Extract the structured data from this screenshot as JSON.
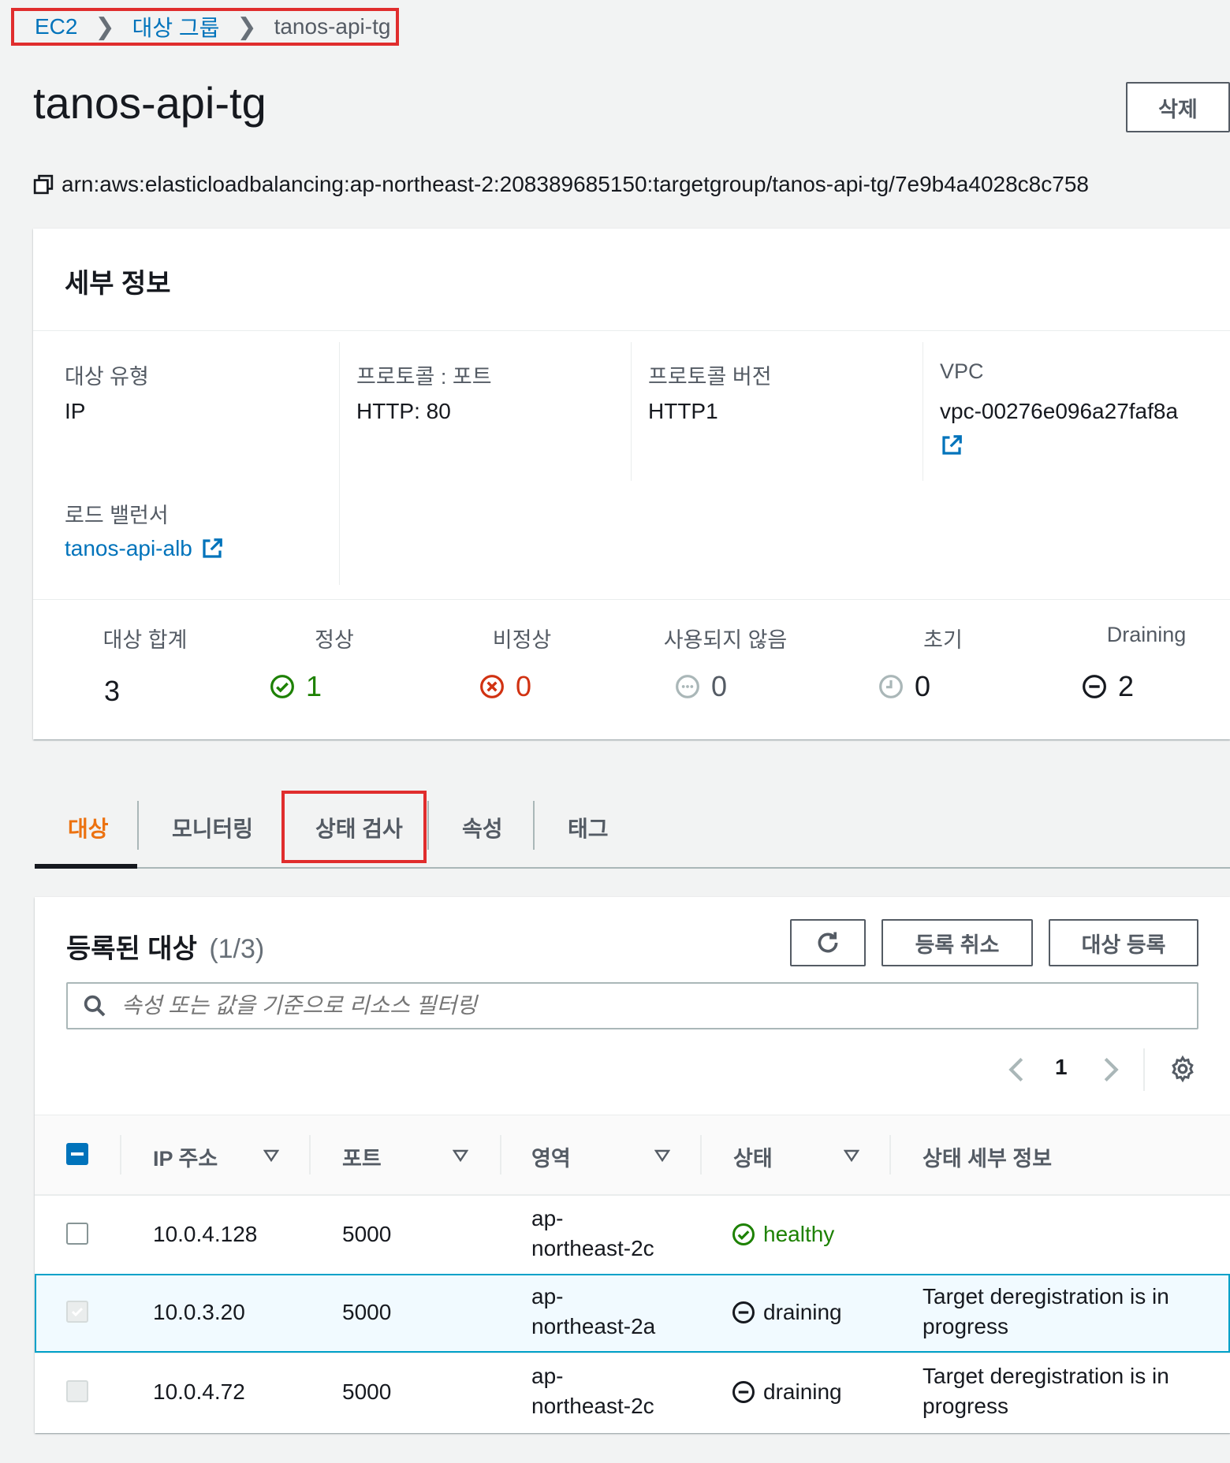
{
  "breadcrumb": {
    "items": [
      "EC2",
      "대상 그룹"
    ],
    "current": "tanos-api-tg"
  },
  "header": {
    "title": "tanos-api-tg",
    "delete_label": "삭제",
    "arn": "arn:aws:elasticloadbalancing:ap-northeast-2:208389685150:targetgroup/tanos-api-tg/7e9b4a4028c8c758"
  },
  "details": {
    "title": "세부 정보",
    "target_type_label": "대상 유형",
    "target_type": "IP",
    "protocol_port_label": "프로토콜 : 포트",
    "protocol_port": "HTTP: 80",
    "protocol_version_label": "프로토콜 버전",
    "protocol_version": "HTTP1",
    "vpc_label": "VPC",
    "vpc": "vpc-00276e096a27faf8a",
    "lb_label": "로드 밸런서",
    "lb": "tanos-api-alb"
  },
  "stats": {
    "total_label": "대상 합계",
    "total": "3",
    "healthy_label": "정상",
    "healthy": "1",
    "unhealthy_label": "비정상",
    "unhealthy": "0",
    "unused_label": "사용되지 않음",
    "unused": "0",
    "initial_label": "초기",
    "initial": "0",
    "draining_label": "Draining",
    "draining": "2"
  },
  "tabs": [
    "대상",
    "모니터링",
    "상태 검사",
    "속성",
    "태그"
  ],
  "targets": {
    "title": "등록된 대상",
    "count": "(1/3)",
    "deregister_label": "등록 취소",
    "register_label": "대상 등록",
    "search_placeholder": "속성 또는 값을 기준으로 리소스 필터링",
    "page": "1",
    "columns": [
      "IP 주소",
      "포트",
      "영역",
      "상태",
      "상태 세부 정보"
    ],
    "rows": [
      {
        "ip": "10.0.4.128",
        "port": "5000",
        "zone_1": "ap-",
        "zone_2": "northeast-2c",
        "status": "healthy",
        "detail_1": "",
        "detail_2": ""
      },
      {
        "ip": "10.0.3.20",
        "port": "5000",
        "zone_1": "ap-",
        "zone_2": "northeast-2a",
        "status": "draining",
        "detail_1": "Target deregistration is in",
        "detail_2": "progress"
      },
      {
        "ip": "10.0.4.72",
        "port": "5000",
        "zone_1": "ap-",
        "zone_2": "northeast-2c",
        "status": "draining",
        "detail_1": "Target deregistration is in",
        "detail_2": "progress"
      }
    ]
  },
  "colors": {
    "link": "#0073bb",
    "healthy": "#1d8102",
    "unhealthy": "#d13212",
    "active_tab": "#ec7211",
    "highlight": "#e02d2d"
  }
}
